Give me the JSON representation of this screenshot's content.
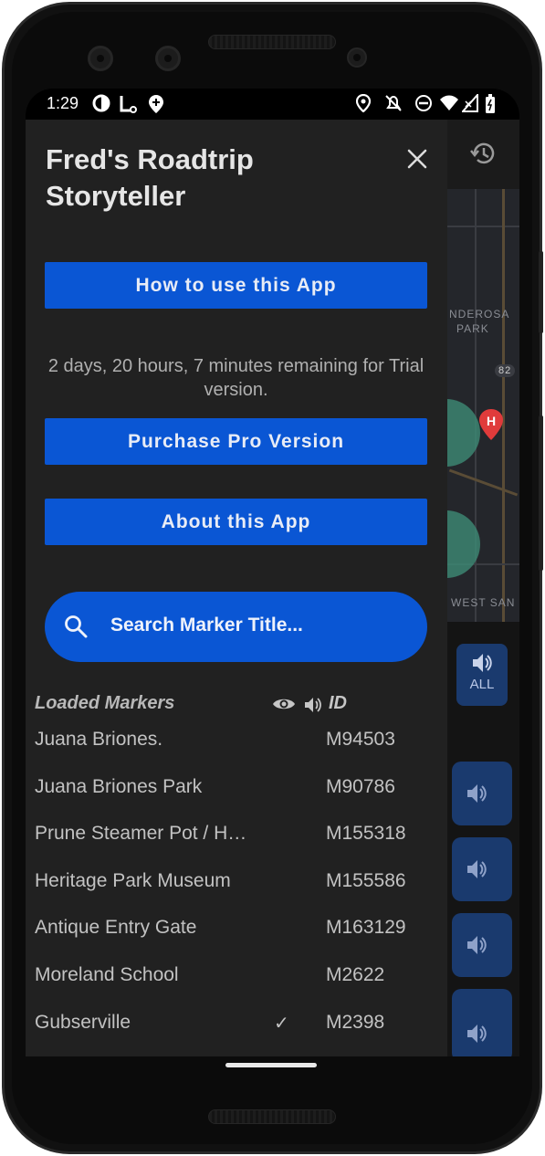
{
  "status_bar": {
    "time": "1:29",
    "left_icons": [
      "data-saver-icon",
      "fitness-tracker-icon",
      "location-add-icon"
    ],
    "right_icons": [
      "location-pin-icon",
      "notifications-off-icon",
      "do-not-disturb-icon",
      "wifi-icon",
      "signal-icon",
      "battery-icon"
    ]
  },
  "drawer": {
    "app_title": "Fred's Roadtrip Storyteller",
    "how_to_button": "How to use this App",
    "trial_text": "2 days, 20 hours, 7 minutes remaining for Trial version.",
    "purchase_button": "Purchase Pro Version",
    "about_button": "About this App",
    "search_placeholder": "Search Marker Title..."
  },
  "markers": {
    "header_title": "Loaded Markers",
    "header_id": "ID",
    "rows": [
      {
        "title": "Juana Briones.",
        "seen": "",
        "id": "M94503"
      },
      {
        "title": "Juana Briones Park",
        "seen": "",
        "id": "M90786"
      },
      {
        "title": "Prune Steamer Pot / H…",
        "seen": "",
        "id": "M155318"
      },
      {
        "title": "Heritage Park Museum",
        "seen": "",
        "id": "M155586"
      },
      {
        "title": "Antique Entry Gate",
        "seen": "",
        "id": "M163129"
      },
      {
        "title": "Moreland School",
        "seen": "",
        "id": "M2622"
      },
      {
        "title": "Gubserville",
        "seen": "✓",
        "id": "M2398"
      }
    ]
  },
  "background_app": {
    "map_labels": [
      "NDEROSA",
      "PARK",
      "82",
      "WEST SAN"
    ],
    "all_label": "ALL"
  },
  "colors": {
    "accent": "#0a56d4",
    "drawer_bg": "#212121"
  }
}
